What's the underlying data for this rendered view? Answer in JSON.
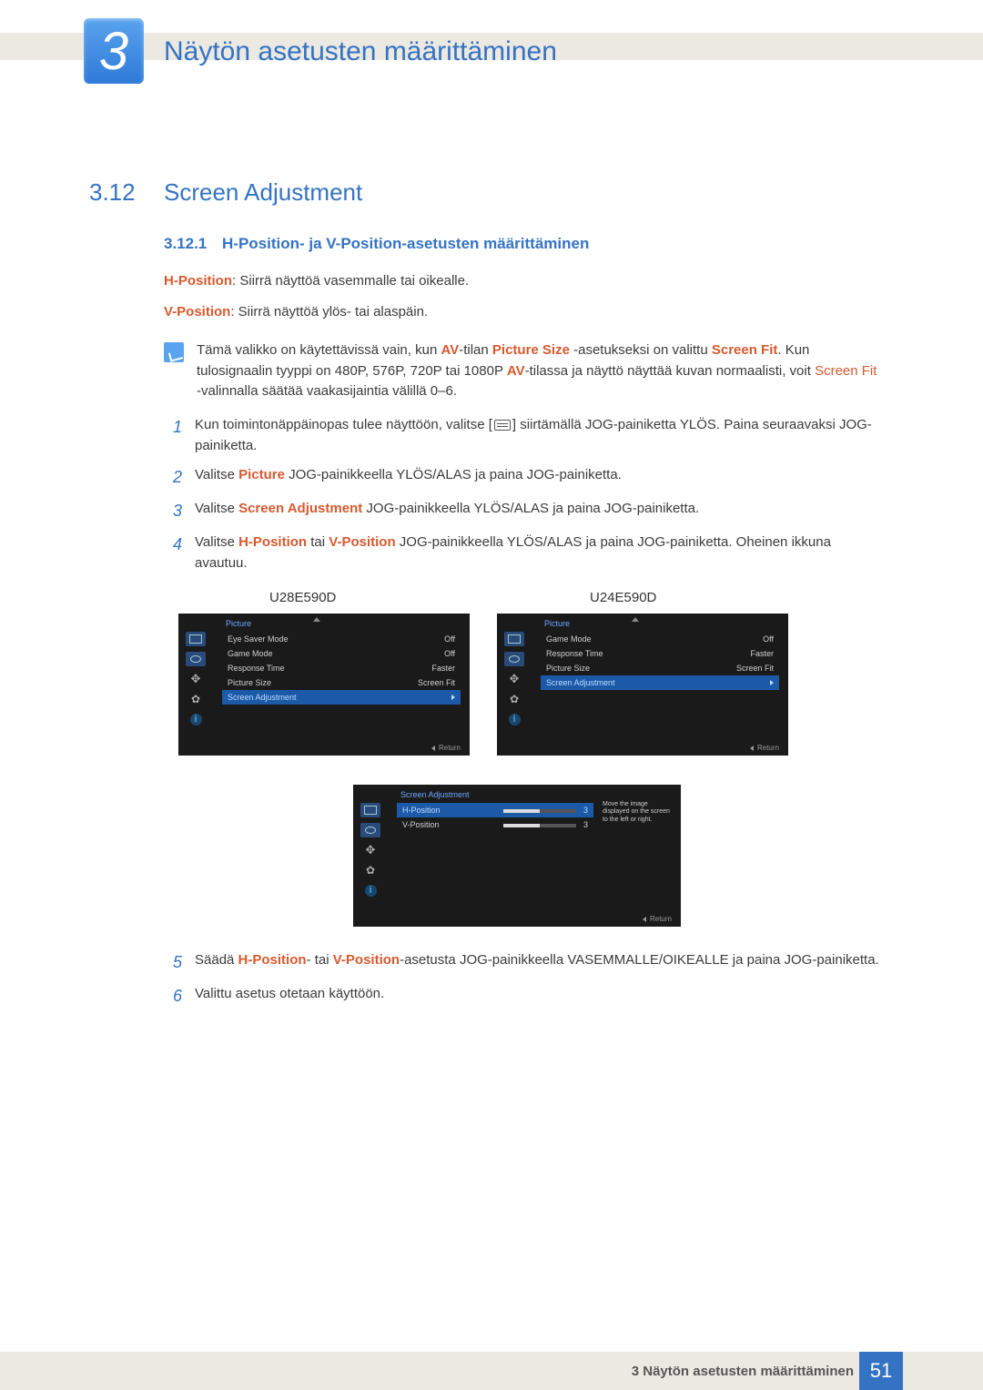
{
  "chapter": {
    "number": "3",
    "title": "Näytön asetusten määrittäminen"
  },
  "section": {
    "number": "3.12",
    "title": "Screen Adjustment"
  },
  "subsection": {
    "number": "3.12.1",
    "title": "H-Position- ja V-Position-asetusten määrittäminen"
  },
  "definitions": {
    "hpos_label": "H-Position",
    "hpos_text": ": Siirrä näyttöä vasemmalle tai oikealle.",
    "vpos_label": "V-Position",
    "vpos_text": ": Siirrä näyttöä ylös- tai alaspäin."
  },
  "note": {
    "p1a": "Tämä valikko on käytettävissä vain, kun ",
    "av1": "AV",
    "p1b": "-tilan ",
    "psize": "Picture Size",
    "p1c": " -asetukseksi on valittu ",
    "sfit": "Screen Fit",
    "p1d": ". Kun tulosignaalin tyyppi on 480P, 576P, 720P tai 1080P ",
    "av2": "AV",
    "p1e": "-tilassa ja näyttö näyttää kuvan normaalisti, voit ",
    "sfit2": "Screen Fit",
    "p1f": " -valinnalla säätää vaakasijaintia välillä 0–6."
  },
  "steps": {
    "s1": {
      "n": "1",
      "a": "Kun toimintonäppäinopas tulee näyttöön, valitse [",
      "b": "] siirtämällä JOG-painiketta YLÖS. Paina seuraavaksi JOG-painiketta."
    },
    "s2": {
      "n": "2",
      "a": "Valitse ",
      "pic": "Picture",
      "b": " JOG-painikkeella YLÖS/ALAS ja paina JOG-painiketta."
    },
    "s3": {
      "n": "3",
      "a": "Valitse ",
      "sa": "Screen Adjustment",
      "b": " JOG-painikkeella YLÖS/ALAS ja paina JOG-painiketta."
    },
    "s4": {
      "n": "4",
      "a": "Valitse ",
      "hp": "H-Position",
      "mid": " tai ",
      "vp": "V-Position",
      "b": " JOG-painikkeella YLÖS/ALAS ja paina JOG-painiketta. Oheinen ikkuna avautuu."
    },
    "s5": {
      "n": "5",
      "a": "Säädä ",
      "hp": "H-Position",
      "mid": "- tai ",
      "vp": "V-Position",
      "b": "-asetusta JOG-painikkeella VASEMMALLE/OIKEALLE ja paina JOG-painiketta."
    },
    "s6": {
      "n": "6",
      "a": "Valittu asetus otetaan käyttöön."
    }
  },
  "osd": {
    "model1": "U28E590D",
    "model2": "U24E590D",
    "menu1": {
      "title": "Picture",
      "rows": [
        {
          "label": "Eye Saver Mode",
          "value": "Off"
        },
        {
          "label": "Game Mode",
          "value": "Off"
        },
        {
          "label": "Response Time",
          "value": "Faster"
        },
        {
          "label": "Picture Size",
          "value": "Screen Fit"
        },
        {
          "label": "Screen Adjustment",
          "value": "",
          "selected": true
        }
      ]
    },
    "menu2": {
      "title": "Picture",
      "rows": [
        {
          "label": "Game Mode",
          "value": "Off"
        },
        {
          "label": "Response Time",
          "value": "Faster"
        },
        {
          "label": "Picture Size",
          "value": "Screen Fit"
        },
        {
          "label": "Screen Adjustment",
          "value": "",
          "selected": true
        }
      ]
    },
    "menu3": {
      "title": "Screen Adjustment",
      "tooltip": "Move the image displayed on the screen to the left or right.",
      "rows": [
        {
          "label": "H-Position",
          "value": "3",
          "selected": true
        },
        {
          "label": "V-Position",
          "value": "3"
        }
      ]
    },
    "return": "Return"
  },
  "footer": {
    "text": "3 Näytön asetusten määrittäminen",
    "page": "51"
  }
}
